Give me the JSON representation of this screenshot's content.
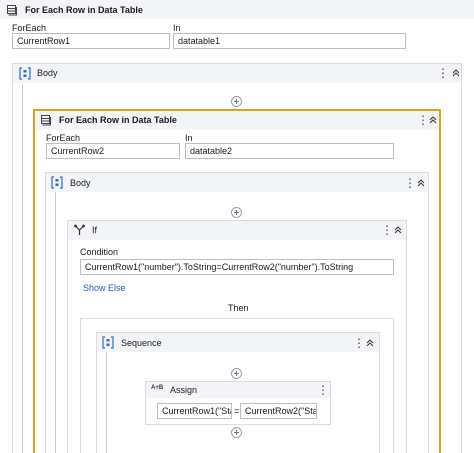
{
  "outer_loop": {
    "title": "For Each Row in Data Table",
    "foreach_label": "ForEach",
    "foreach_value": "CurrentRow1",
    "in_label": "In",
    "in_value": "datatable1",
    "body_label": "Body"
  },
  "inner_loop": {
    "title": "For Each Row in Data Table",
    "foreach_label": "ForEach",
    "foreach_value": "CurrentRow2",
    "in_label": "In",
    "in_value": "datatable2",
    "body_label": "Body"
  },
  "if_activity": {
    "title": "If",
    "condition_label": "Condition",
    "condition_value": "CurrentRow1(\"number\").ToString=CurrentRow2(\"number\").ToString",
    "show_else": "Show Else",
    "then_label": "Then"
  },
  "sequence": {
    "title": "Sequence"
  },
  "assign": {
    "title": "Assign",
    "icon_text": "A+B",
    "to_value": "CurrentRow1(\"Stat",
    "operator": "=",
    "value_value": "CurrentRow2(\"Stat"
  },
  "colors": {
    "selected_border": "#e0a21a",
    "header_bg": "#f2f4f7",
    "link": "#1f5fbf",
    "icon_blue": "#2b6cd4"
  },
  "icons": {
    "loop": "table-loop-icon",
    "body": "sequence-braces-icon",
    "if": "if-branch-icon",
    "assign": "assign-icon"
  }
}
